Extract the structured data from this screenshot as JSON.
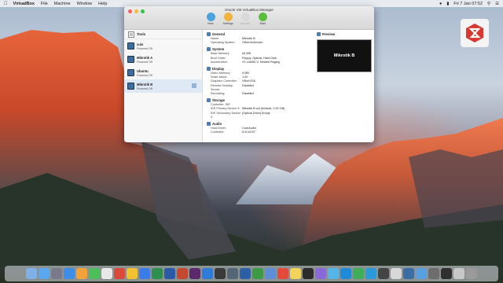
{
  "menubar": {
    "app_name": "VirtualBox",
    "items": [
      "File",
      "Machine",
      "Window",
      "Help"
    ],
    "clock": "Fri 7 Jan 07:52"
  },
  "window": {
    "title": "Oracle VM VirtualBox Manager",
    "toolbar": [
      {
        "label": "New",
        "icon": "new-icon",
        "color": "#4aa3df"
      },
      {
        "label": "Settings",
        "icon": "gear-icon",
        "color": "#f2b33d"
      },
      {
        "label": "Discard",
        "icon": "discard-icon",
        "color": "#d9d9d9"
      },
      {
        "label": "Start",
        "icon": "start-arrow-icon",
        "color": "#5bbf3c"
      }
    ],
    "sidebar": {
      "tools_label": "Tools",
      "vms": [
        {
          "name": "xuis",
          "state": "Powered Off"
        },
        {
          "name": "Mikrotik A",
          "state": "Powered Off"
        },
        {
          "name": "Ubuntu",
          "state": "Powered Off"
        },
        {
          "name": "Mikrotik B",
          "state": "Powered Off"
        }
      ]
    },
    "details": {
      "general": {
        "title": "General",
        "rows": [
          {
            "k": "Name:",
            "v": "Mikrotik B"
          },
          {
            "k": "Operating System:",
            "v": "Other/Unknown"
          }
        ]
      },
      "system": {
        "title": "System",
        "rows": [
          {
            "k": "Base Memory:",
            "v": "64 MB"
          },
          {
            "k": "Boot Order:",
            "v": "Floppy, Optical, Hard Disk"
          },
          {
            "k": "Acceleration:",
            "v": "VT-x/AMD-V, Nested Paging"
          }
        ]
      },
      "display": {
        "title": "Display",
        "rows": [
          {
            "k": "Video Memory:",
            "v": "9 MB"
          },
          {
            "k": "Scale-factor:",
            "v": "1.00"
          },
          {
            "k": "Graphics Controller:",
            "v": "VBoxVGA"
          },
          {
            "k": "Remote Desktop Server:",
            "v": "Disabled"
          },
          {
            "k": "Recording:",
            "v": "Disabled"
          }
        ]
      },
      "storage": {
        "title": "Storage",
        "rows": [
          {
            "k": "Controller: IDE",
            "v": ""
          },
          {
            "k": "IDE Primary Device 0:",
            "v": "Mikrotik B.vdi (Normal, 2.00 GB)"
          },
          {
            "k": "IDE Secondary Device 0:",
            "v": "[Optical Drive] Empty"
          }
        ]
      },
      "audio": {
        "title": "Audio",
        "rows": [
          {
            "k": "Host Driver:",
            "v": "CoreAudio"
          },
          {
            "k": "Controller:",
            "v": "ICH AC97"
          }
        ]
      }
    },
    "preview": {
      "title": "Preview",
      "screen_text": "Mikrotik B"
    }
  },
  "dock": {
    "apps": [
      "#7fb0e8",
      "#5aa9f0",
      "#7a7a8a",
      "#3c8ee8",
      "#f3a33a",
      "#4bbf5a",
      "#e8e8e8",
      "#d94a3a",
      "#f2c230",
      "#3b7de8",
      "#2f8f4f",
      "#2a5aa8",
      "#c34a2f",
      "#5a2a6a",
      "#2f7bd8",
      "#3a3a3a",
      "#556677",
      "#2b5fa6",
      "#3d9b46",
      "#5e8fd6",
      "#e34a3a",
      "#f2d45a",
      "#2c2c2c",
      "#8a6ad8",
      "#54b6e8",
      "#1f8ad8",
      "#3fae5a",
      "#2a9ad8",
      "#444444",
      "#d8d8d8",
      "#3a6ea5",
      "#58a0e0",
      "#6d6d6d",
      "#2f2f2f",
      "#c8c8c8",
      "#9a9a9a"
    ]
  }
}
